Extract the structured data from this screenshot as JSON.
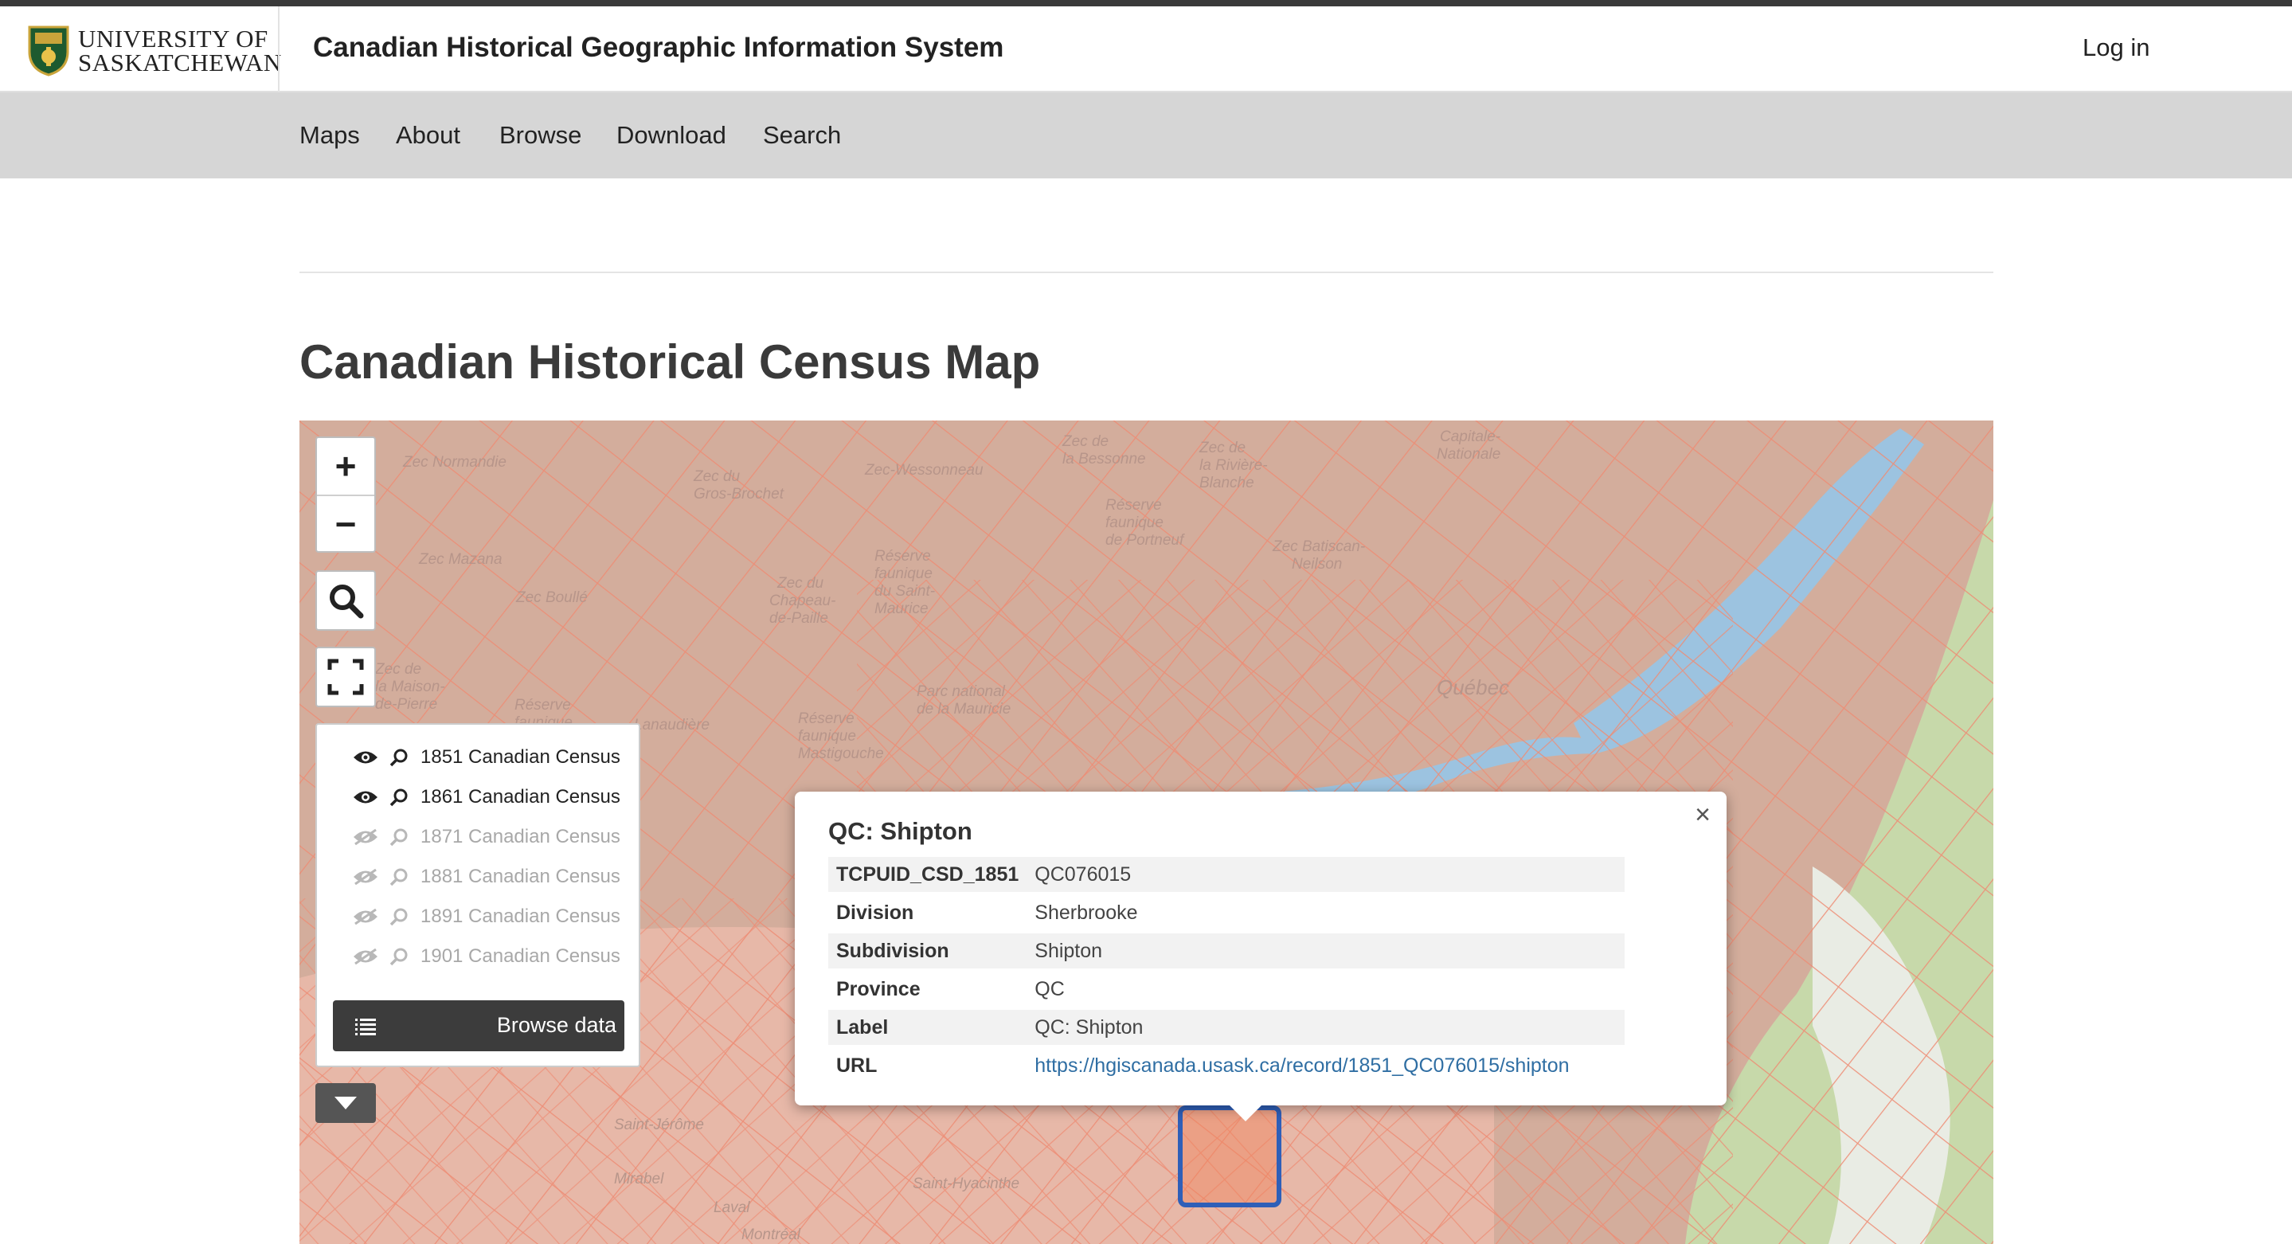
{
  "header": {
    "logo_line1": "UNIVERSITY OF",
    "logo_line2": "SASKATCHEWAN",
    "site_title": "Canadian Historical Geographic Information System",
    "login_label": "Log in"
  },
  "nav": {
    "items": [
      {
        "label": "Maps"
      },
      {
        "label": "About"
      },
      {
        "label": "Browse"
      },
      {
        "label": "Download"
      },
      {
        "label": "Search"
      }
    ]
  },
  "page": {
    "title": "Canadian Historical Census Map"
  },
  "map": {
    "zoom_in_label": "+",
    "zoom_out_label": "−",
    "place_labels": [
      "Zec Normandie",
      "Zec du Gros-Brochet",
      "Zec-Wessonneau",
      "Zec de la Bessonne",
      "Zec de la Rivière-Blanche",
      "Réserve faunique de Portneuf",
      "Zec Mazana",
      "Zec Boullé",
      "Réserve faunique du Saint-Maurice",
      "Zec du Chapeau-de-Paille",
      "Zec Batiscan-Neilson",
      "Capitale-Nationale",
      "Zec de la Maison-de-Pierre",
      "Réserve faunique",
      "Lanaudière",
      "Réserve faunique Mastigouche",
      "Parc national de la Mauricie",
      "Québec",
      "Saint-Jérôme",
      "Mirabel",
      "Laval",
      "Saint-Hyacinthe",
      "Montréal"
    ],
    "layers": [
      {
        "label": "1851 Canadian Census",
        "visible": true
      },
      {
        "label": "1861 Canadian Census",
        "visible": true
      },
      {
        "label": "1871 Canadian Census",
        "visible": false
      },
      {
        "label": "1881 Canadian Census",
        "visible": false
      },
      {
        "label": "1891 Canadian Census",
        "visible": false
      },
      {
        "label": "1901 Canadian Census",
        "visible": false
      }
    ],
    "browse_data_label": "Browse data",
    "popup": {
      "title": "QC: Shipton",
      "close_label": "×",
      "rows": [
        {
          "key": "TCPUID_CSD_1851",
          "value": "QC076015"
        },
        {
          "key": "Division",
          "value": "Sherbrooke"
        },
        {
          "key": "Subdivision",
          "value": "Shipton"
        },
        {
          "key": "Province",
          "value": "QC"
        },
        {
          "key": "Label",
          "value": "QC: Shipton"
        },
        {
          "key": "URL",
          "value": "https://hgiscanada.usask.ca/record/1851_QC076015/shipton"
        }
      ]
    }
  },
  "colors": {
    "nav_bg": "#d6d6d6",
    "map_overlay": "#e89a80",
    "river": "#9cc3e0",
    "forest_green": "#b8d8a0",
    "selected_outline": "#2f5fb8",
    "link": "#2f6ea3"
  }
}
